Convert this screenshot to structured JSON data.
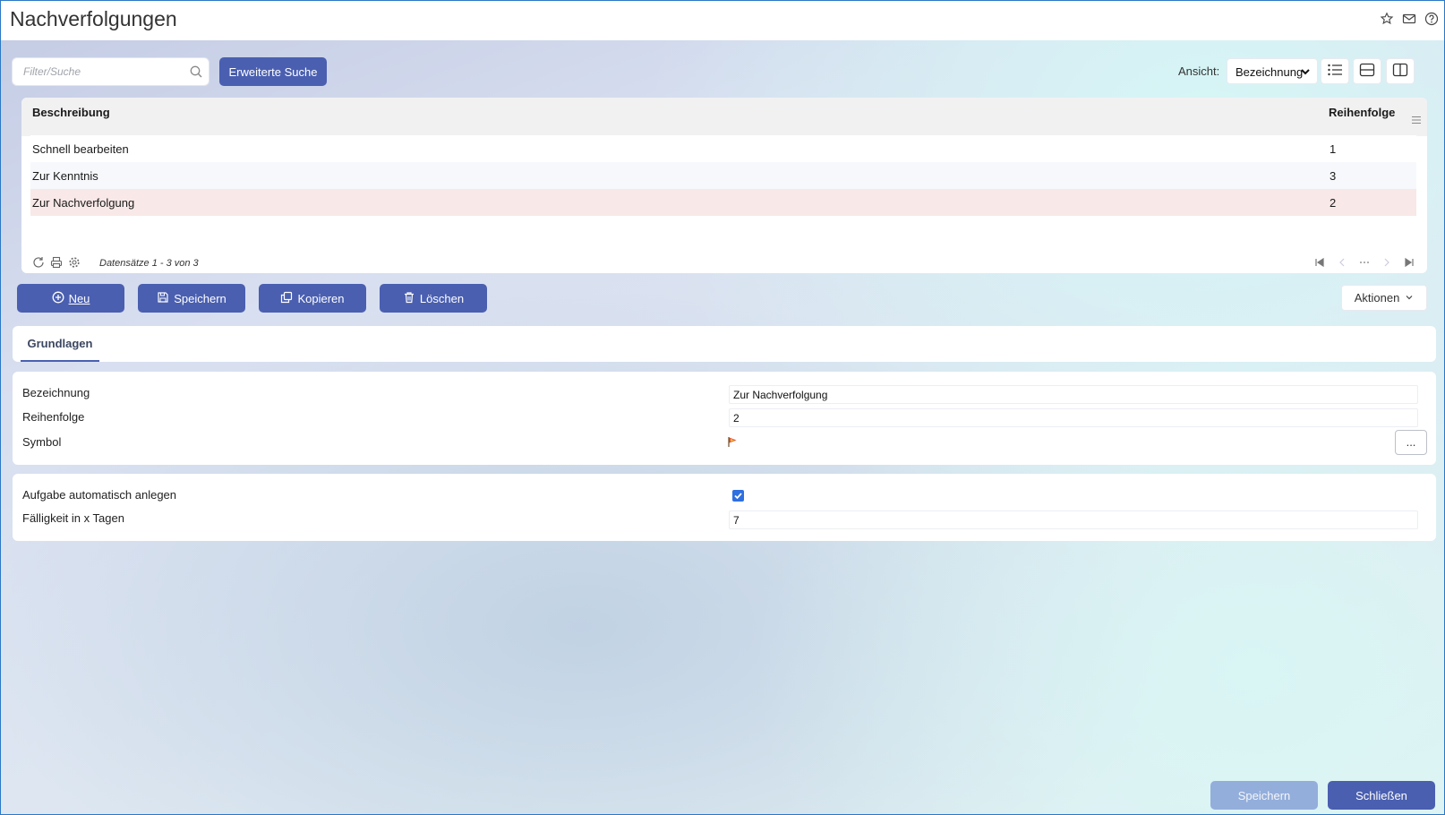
{
  "window": {
    "title": "Nachverfolgungen"
  },
  "header_icons": [
    "star-icon",
    "mail-icon",
    "help-icon"
  ],
  "search": {
    "placeholder": "Filter/Suche",
    "value": ""
  },
  "toolbar": {
    "advanced_search_label": "Erweiterte Suche",
    "view_label": "Ansicht:",
    "view_selected": "Bezeichnung"
  },
  "grid": {
    "columns": [
      "Beschreibung",
      "Reihenfolge"
    ],
    "rows": [
      {
        "beschreibung": "Schnell bearbeiten",
        "reihenfolge": "1"
      },
      {
        "beschreibung": "Zur Kenntnis",
        "reihenfolge": "3"
      },
      {
        "beschreibung": "Zur Nachverfolgung",
        "reihenfolge": "2",
        "selected": true
      }
    ],
    "records_text": "Datensätze 1 - 3 von 3"
  },
  "actions": {
    "new_label": "Neu",
    "save_label": "Speichern",
    "copy_label": "Kopieren",
    "delete_label": "Löschen",
    "more_label": "Aktionen"
  },
  "tabs": [
    {
      "label": "Grundlagen",
      "active": true
    }
  ],
  "form": {
    "bezeichnung_label": "Bezeichnung",
    "bezeichnung_value": "Zur Nachverfolgung",
    "reihenfolge_label": "Reihenfolge",
    "reihenfolge_value": "2",
    "symbol_label": "Symbol",
    "symbol_icon": "flag-icon",
    "symbol_button_label": "...",
    "auto_task_label": "Aufgabe automatisch anlegen",
    "auto_task_checked": true,
    "faelligkeit_label": "Fälligkeit in x Tagen",
    "faelligkeit_value": "7"
  },
  "footer": {
    "save_label": "Speichern",
    "close_label": "Schließen"
  },
  "colors": {
    "primary": "#4a5fb0",
    "selected_row": "#f8e8e8",
    "disabled_button": "#93aedb"
  }
}
